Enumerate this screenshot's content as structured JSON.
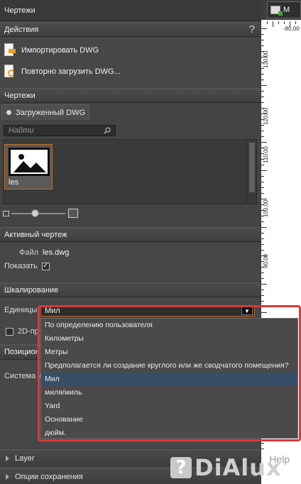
{
  "panel": {
    "title": "Чертежи",
    "actions_header": "Действия",
    "help_label": "?",
    "actions": [
      {
        "label": "Импортировать DWG",
        "icon": "import-dwg-icon"
      },
      {
        "label": "Повторно загрузить DWG...",
        "icon": "reload-dwg-icon"
      }
    ],
    "drawings_header": "Чертежи",
    "tab_label": "Загруженный DWG",
    "search_placeholder": "Найти",
    "thumbnail_label": "les",
    "active_drawing_header": "Активный чертеж",
    "file_label": "Файл",
    "file_value": "les.dwg",
    "show_label": "Показать",
    "show_checked": true,
    "scaling_header": "Шкалирование",
    "units_label": "Единицы",
    "units_value": "Мил",
    "twod_label": "2D-пр",
    "position_header": "Позицион",
    "system_label": "Система к",
    "layer_label": "Layer",
    "save_options_label": "Опции сохранения"
  },
  "dropdown": {
    "options": [
      "По определению пользователя",
      "Километры",
      "Метры",
      "Предполагается ли создание круглого или же сводчатого помещения?",
      "Мил",
      "миля/миль",
      "Yard",
      "Основание",
      "дюйм."
    ],
    "selected_index": 4
  },
  "ruler": {
    "button_label": "M",
    "h_label": "-80,00",
    "v_labels": [
      "130,00",
      "120,00",
      "110,00",
      "100,00",
      "90,00"
    ]
  },
  "watermark": {
    "text": "DiAlux",
    "help": "Help",
    "q": "?"
  },
  "colors": {
    "accent_orange": "#c25a18",
    "highlight_red": "#d83b3b",
    "selected_blue": "#384e68"
  }
}
